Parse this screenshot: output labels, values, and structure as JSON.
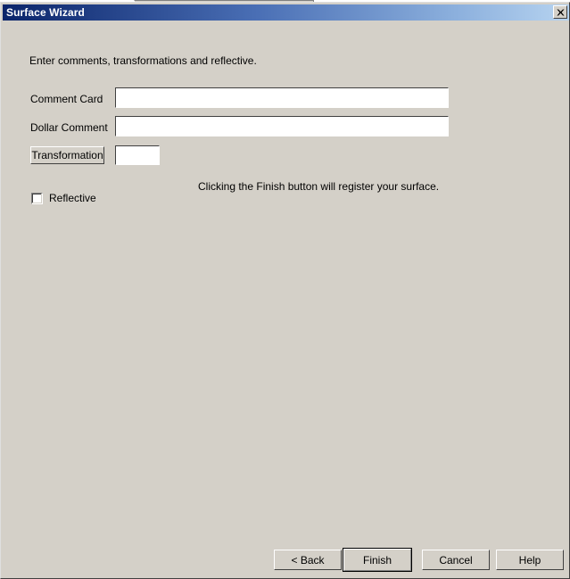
{
  "window": {
    "title": "Surface Wizard",
    "close_icon": "close-x-icon"
  },
  "body": {
    "instruction": "Enter comments, transformations and reflective.",
    "hint": "Clicking the Finish button will register your surface."
  },
  "fields": {
    "comment_card": {
      "label": "Comment Card",
      "value": "",
      "placeholder": ""
    },
    "dollar_comment": {
      "label": "Dollar Comment",
      "value": "",
      "placeholder": ""
    },
    "transformation": {
      "button_label": "Transformation",
      "value": "",
      "placeholder": ""
    },
    "reflective": {
      "label": "Reflective",
      "checked": false
    }
  },
  "buttons": {
    "back": "< Back",
    "finish": "Finish",
    "cancel": "Cancel",
    "help": "Help"
  },
  "colors": {
    "dialog_face": "#d4d0c8",
    "title_gradient_start": "#0a246a",
    "title_gradient_end": "#b6d3f0",
    "title_text": "#ffffff",
    "field_background": "#ffffff"
  }
}
